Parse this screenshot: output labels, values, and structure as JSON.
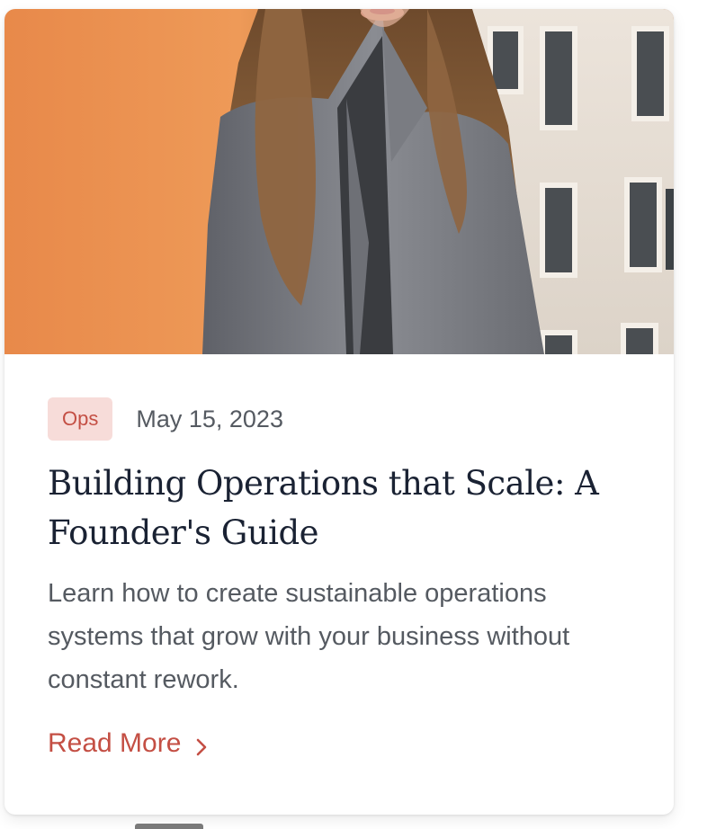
{
  "card": {
    "image_alt": "Woman with long hair wearing a grey blazer",
    "tag": "Ops",
    "date": "May 15, 2023",
    "title": "Building Operations that Scale: A Founder's Guide",
    "excerpt": "Learn how to create sustainable operations systems that grow with your business without constant rework.",
    "read_more_label": "Read More",
    "read_more_icon": "chevron-right-icon"
  },
  "colors": {
    "accent": "#c44f44",
    "tag_background": "#f7dcd9",
    "title_text": "#1a2233",
    "body_text": "#555a61"
  }
}
